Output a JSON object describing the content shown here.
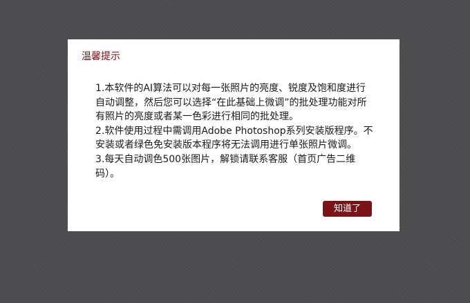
{
  "colors": {
    "backdrop": "#4d4d4f",
    "dialog_background": "#ffffff",
    "accent": "#7a1218",
    "body_text": "#1a1a1a"
  },
  "dialog": {
    "title": "温馨提示",
    "paragraphs": [
      "1.本软件的AI算法可以对每一张照片的亮度、锐度及饱和度进行自动调整，然后您可以选择“在此基础上微调”的批处理功能对所有照片的亮度或者某一色彩进行相同的批处理。",
      "2.软件使用过程中需调用Adobe Photoshop系列安装版程序。不安装或者绿色免安装版本程序将无法调用进行单张照片微调。",
      "3.每天自动调色500张图片，解锁请联系客服（首页广告二维码）。"
    ],
    "ok_button_label": "知道了"
  }
}
